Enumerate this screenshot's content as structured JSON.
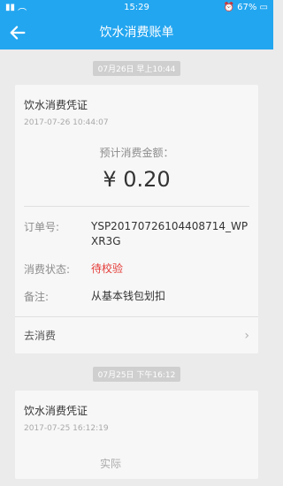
{
  "status": {
    "time": "15:29",
    "battery": "67%"
  },
  "appbar": {
    "title": "饮水消费账单"
  },
  "records": [
    {
      "time_sep": "07月26日 早上10:44",
      "card_title": "饮水消费凭证",
      "datetime": "2017-07-26 10:44:07",
      "amount_label": "预计消费金额：",
      "amount": "¥ 0.20",
      "order_key": "订单号:",
      "order_val": "YSP20170726104408714_WPXR3G",
      "status_key": "消费状态:",
      "status_val": "待校验",
      "note_key": "备注:",
      "note_val": "从基本钱包划扣",
      "action": "去消费"
    },
    {
      "time_sep": "07月25日 下午16:12",
      "card_title": "饮水消费凭证",
      "datetime": "2017-07-25 16:12:19",
      "amount_label_partial": "实际"
    }
  ]
}
